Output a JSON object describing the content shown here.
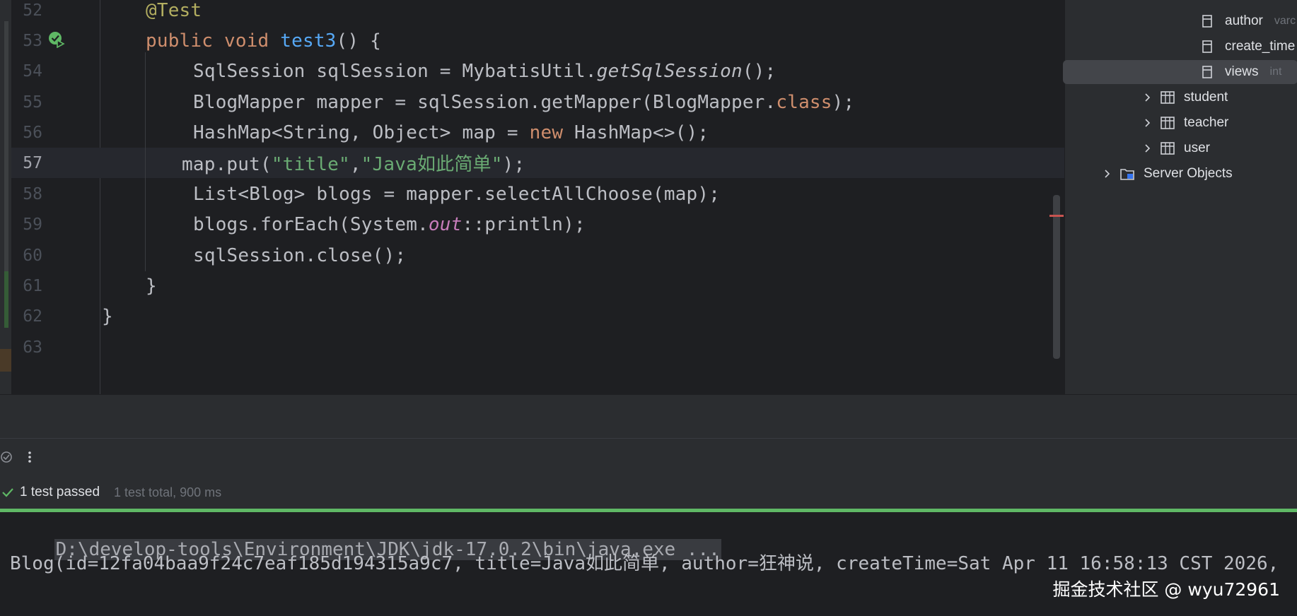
{
  "editor": {
    "lines": [
      {
        "num": "52"
      },
      {
        "num": "53"
      },
      {
        "num": "54"
      },
      {
        "num": "55"
      },
      {
        "num": "56"
      },
      {
        "num": "57"
      },
      {
        "num": "58"
      },
      {
        "num": "59"
      },
      {
        "num": "60"
      },
      {
        "num": "61"
      },
      {
        "num": "62"
      },
      {
        "num": "63"
      }
    ],
    "code": {
      "l52": "@Test",
      "l53_kw1": "public",
      "l53_kw2": "void",
      "l53_fn": "test3",
      "l53_rest": "() {",
      "l54_a": "SqlSession sqlSession = MybatisUtil.",
      "l54_b": "getSqlSession",
      "l54_c": "();",
      "l55_a": "BlogMapper mapper = sqlSession.getMapper(BlogMapper.",
      "l55_b": "class",
      "l55_c": ");",
      "l56_a": "HashMap<String, Object> map = ",
      "l56_b": "new",
      "l56_c": " HashMap<>();",
      "l57_a": "map.put(",
      "l57_b": "\"title\"",
      "l57_c": ",",
      "l57_d": "\"Java如此简单\"",
      "l57_e": ");",
      "l58": "List<Blog> blogs = mapper.selectAllChoose(map);",
      "l59_a": "blogs.forEach(System.",
      "l59_b": "out",
      "l59_c": "::println);",
      "l60": "sqlSession.close();",
      "l61": "}",
      "l62": "}"
    }
  },
  "db_tree": {
    "items": [
      {
        "label": "author",
        "type": "varc"
      },
      {
        "label": "create_time",
        "type": ""
      },
      {
        "label": "views",
        "type": "int"
      },
      {
        "label": "student"
      },
      {
        "label": "teacher"
      },
      {
        "label": "user"
      },
      {
        "label": "Server Objects"
      }
    ]
  },
  "run_panel": {
    "status_label": "1 test passed",
    "summary": "1 test total, 900 ms"
  },
  "console": {
    "command": "D:\\develop-tools\\Environment\\JDK\\jdk-17.0.2\\bin\\java.exe ...",
    "output": "Blog(id=12fa04baa9f24c7eaf185d194315a9c7, title=Java如此简单, author=狂神说, createTime=Sat Apr 11 16:58:13 CST 2026,"
  },
  "watermark": "掘金技术社区 @ wyu72961",
  "colors": {
    "keyword": "#cf8e6d",
    "annotation": "#b3ae60",
    "function": "#56a8f5",
    "string": "#6aab73",
    "static_field": "#c77dbb",
    "success": "#5fb865"
  }
}
